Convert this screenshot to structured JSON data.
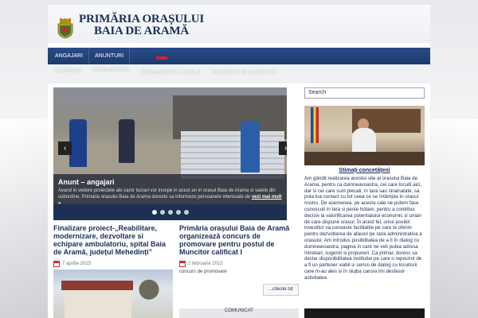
{
  "header": {
    "title_line1": "PRIMĂRIA ORAȘULUI",
    "title_line2": "BAIA DE ARAMĂ"
  },
  "nav_primary": [
    "ANGAJARI",
    "ANUNTURI"
  ],
  "nav_secondary": [
    "CAMPANII",
    "COMUNICATE",
    "EVENIMENTE LOCALE",
    "PROIECTE SI INVESTITII"
  ],
  "slider": {
    "caption_title": "Anunt – angajari",
    "caption_text": "Avand in vedere proiectele ale caror lucrari vor incepe in acest an in orasul Baia de Arama si satele din subordine, Primaria orasului Baia de Arama doreste sa informeze persoanele interesate de",
    "caption_link": "vezi mai mult »",
    "prev_arrow": "‹",
    "next_arrow": "›",
    "slide_count": 5,
    "active_slide": 1
  },
  "posts": [
    {
      "title": "Finalizare proiect-„Reabilitare, modernizare, dezvoltare si echipare ambulatoriu, spital Baia de Aramă, județul Mehedinți”",
      "date": "7 aprilie 2015"
    },
    {
      "title": "Primăria orașului Baia de Aramă organizează concurs de promovare pentru postul de Muncitor calificat I",
      "date": "2 februarie 2015",
      "excerpt": "concurs de promovare",
      "read_more": "...citeste tot"
    }
  ],
  "bottom_thumb_label": "COMUNICAT",
  "sidebar": {
    "search_placeholder": "Search",
    "title": "Stimați concetățeni",
    "text": "Am gândit realizarea acestui site al orasului Baia de Arama, pentru ca dumneavoastra, cei care locuiti aici, dar si cei care sunt plecati, in tara sau strainatate, sa puta lua contact cu tot ceea ce se întâmpla în orasul nostru. De asemenea, pe acesta cale ne putem face cunoscuti in tara si peste hotare, pentru a contribui decisiv la valorificarea potentialului economic si uman de care dispune orasul. În acest fel, orice posibil investitor va cunoaste facilitatile pe care le oferim pentru dezvoltarea de afaceri pe raza administrativa a orasului. Am introdus posibilitatea de a fi în dialog cu dumneavoastra, pagina in care ne veti putea adresa întrebari, sugestii si propuneri. Ca primar, doresc sa declar disponibilitatea institutiei pe care o reprezint de a fi un partener viabil si serios de dialog cu locuitorii care m-au ales si în slujba carora imi desfasor activitatea."
  },
  "colors": {
    "brand_navy": "#1d3a6e",
    "title_navy": "#1a2e5a"
  }
}
